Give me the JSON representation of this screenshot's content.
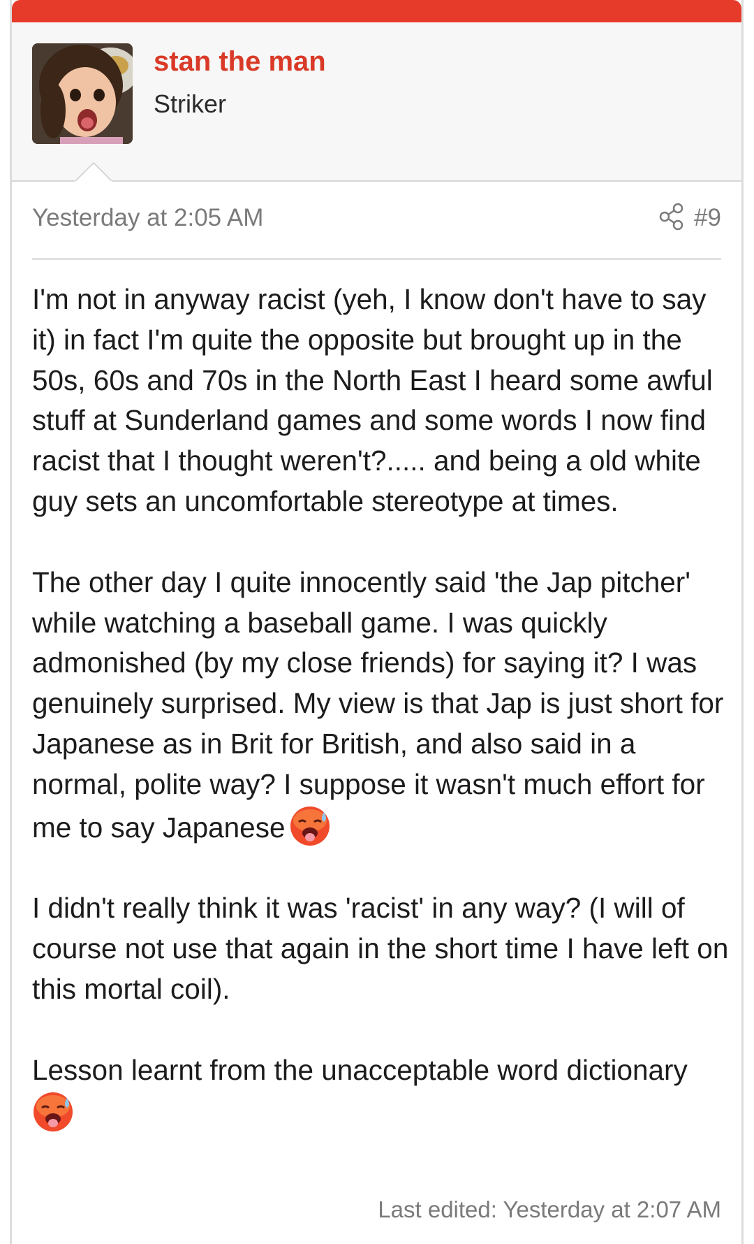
{
  "accent_color": "#e63a2a",
  "user": {
    "name": "stan the man",
    "title": "Striker",
    "avatar_icon": "user-avatar-photo"
  },
  "post": {
    "timestamp": "Yesterday at 2:05 AM",
    "number": "#9",
    "share_icon": "share-icon",
    "paragraphs": [
      "I'm not in anyway racist (yeh, I know don't have to say it) in fact I'm quite the opposite but brought up in the 50s, 60s and 70s in the North East I heard some awful stuff at Sunderland games and some words I now find racist that I thought weren't?..... and being a old white guy sets an uncomfortable stereotype at times.",
      "The other day I quite innocently said 'the Jap pitcher' while watching a baseball game. I was quickly admonished (by my close friends) for saying it? I was genuinely surprised. My view is that Jap is just short for Japanese as in Brit for British, and also said in a normal, polite way? I suppose it wasn't much effort for me to say Japanese",
      "I didn't really think it was 'racist' in any way? (I will of course not use that again in the short time I have left on this mortal coil).",
      "Lesson learnt from the unacceptable word dictionary"
    ],
    "emoji_icon": "hot-face-emoji",
    "last_edited": "Last edited: Yesterday at 2:07 AM"
  }
}
